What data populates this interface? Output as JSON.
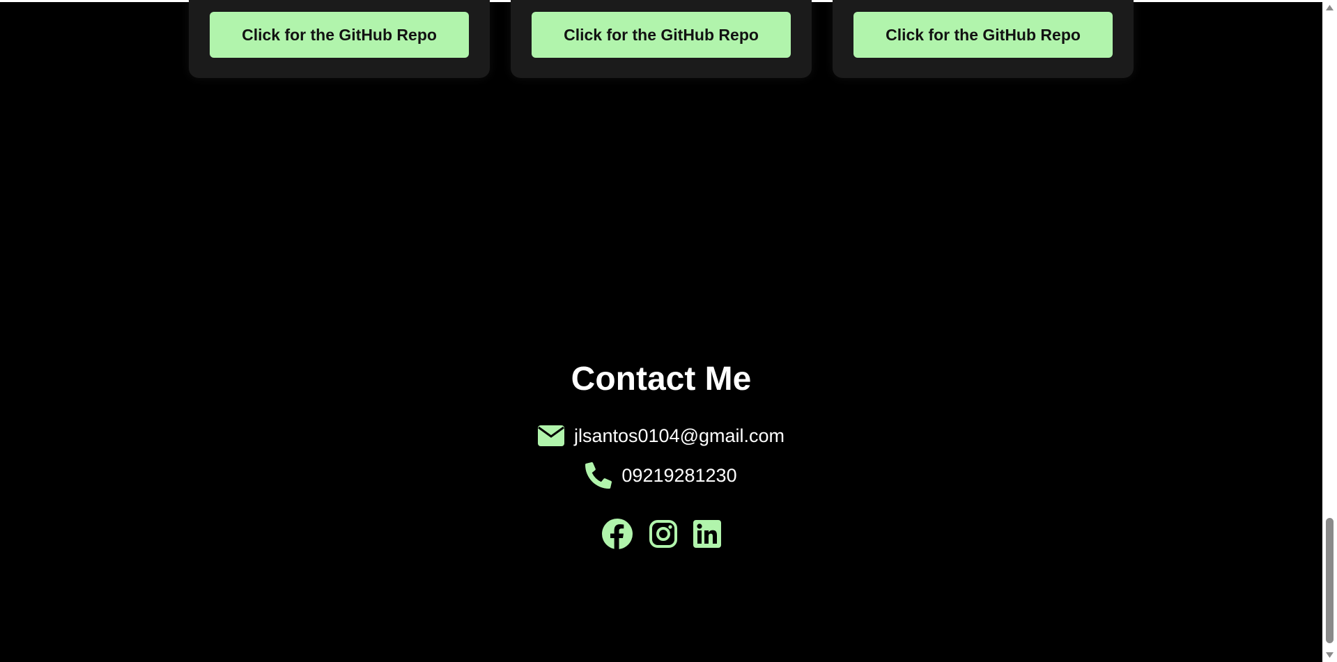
{
  "projects": {
    "buttons": [
      {
        "label": "Click for the GitHub Repo"
      },
      {
        "label": "Click for the GitHub Repo"
      },
      {
        "label": "Click for the GitHub Repo"
      }
    ]
  },
  "contact": {
    "title": "Contact Me",
    "email": "jlsantos0104@gmail.com",
    "phone": "09219281230",
    "email_icon": "envelope-icon",
    "phone_icon": "phone-icon",
    "socials": [
      {
        "icon": "facebook-icon"
      },
      {
        "icon": "instagram-icon"
      },
      {
        "icon": "linkedin-icon"
      }
    ]
  },
  "colors": {
    "background": "#000000",
    "accent": "#b1f4ac",
    "card": "#1b1b1b",
    "text": "#ffffff"
  }
}
